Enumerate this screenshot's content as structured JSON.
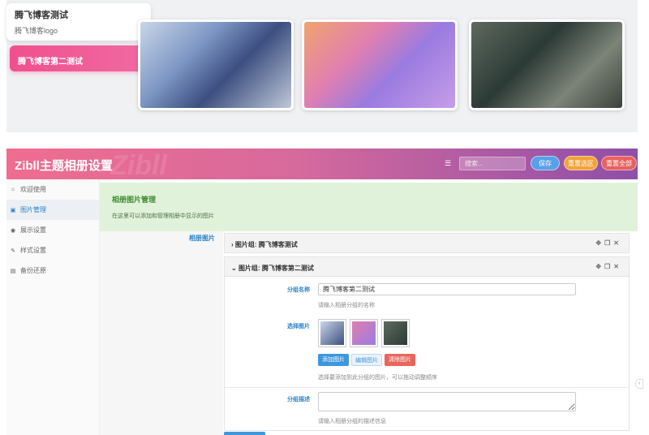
{
  "preview": {
    "card_title": "腾飞博客测试",
    "card_subtitle": "腾飞博客logo",
    "second_tab": "腾飞博客第二测试"
  },
  "header": {
    "title": "Zibll主题相册设置",
    "search_placeholder": "搜索...",
    "save": "保存",
    "reset_section": "重置选区",
    "reset_all": "重置全部"
  },
  "sidebar": {
    "items": [
      {
        "label": "欢迎使用",
        "icon": "home-icon"
      },
      {
        "label": "图片管理",
        "icon": "camera-icon"
      },
      {
        "label": "展示设置",
        "icon": "eye-icon"
      },
      {
        "label": "样式设置",
        "icon": "brush-icon"
      },
      {
        "label": "备份还原",
        "icon": "database-icon"
      }
    ]
  },
  "notice": {
    "title": "相册图片管理",
    "text": "在这里可以添加和管理相册中显示的图片"
  },
  "field_label": "相册图片",
  "groups": [
    {
      "label": "图片组: 腾飞博客测试",
      "expanded": false
    },
    {
      "label": "图片组: 腾飞博客第二测试",
      "expanded": true
    }
  ],
  "form": {
    "name_label": "分组名称",
    "name_value": "腾飞博客第二测试",
    "name_hint": "请输入相册分组的名称",
    "images_label": "选择图片",
    "add_btn": "添加图片",
    "edit_btn": "编辑图片",
    "clear_btn": "清除图片",
    "images_hint": "选择要添加到此分组的图片，可以拖动调整顺序",
    "desc_label": "分组描述",
    "desc_hint": "请输入相册分组的描述信息"
  }
}
